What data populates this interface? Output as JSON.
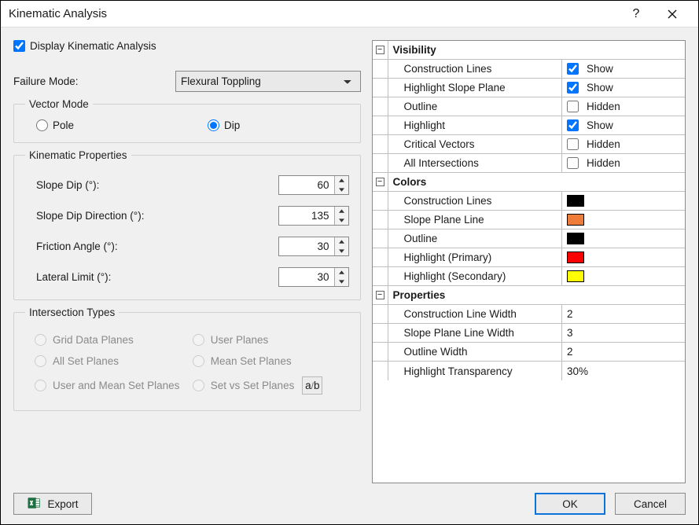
{
  "title": "Kinematic Analysis",
  "main_checkbox_label": "Display Kinematic Analysis",
  "main_checkbox_checked": true,
  "failure_mode": {
    "label": "Failure Mode:",
    "value": "Flexural Toppling"
  },
  "vector_mode": {
    "legend": "Vector Mode",
    "pole": "Pole",
    "dip": "Dip",
    "selected": "dip"
  },
  "kinematic_properties": {
    "legend": "Kinematic Properties",
    "slope_dip": {
      "label": "Slope Dip (°):",
      "value": "60"
    },
    "slope_dip_direction": {
      "label": "Slope Dip Direction (°):",
      "value": "135"
    },
    "friction_angle": {
      "label": "Friction Angle (°):",
      "value": "30"
    },
    "lateral_limit": {
      "label": "Lateral Limit (°):",
      "value": "30"
    }
  },
  "intersection_types": {
    "legend": "Intersection Types",
    "options": {
      "grid": "Grid Data Planes",
      "user": "User Planes",
      "allset": "All Set Planes",
      "meanset": "Mean Set Planes",
      "usermean": "User and Mean Set Planes",
      "setvs": "Set vs Set Planes"
    },
    "tool_btn": "a/b"
  },
  "propgrid": {
    "visibility": {
      "title": "Visibility",
      "rows": {
        "construction": {
          "name": "Construction Lines",
          "checked": true,
          "text": "Show"
        },
        "highlight_sp": {
          "name": "Highlight Slope Plane",
          "checked": true,
          "text": "Show"
        },
        "outline": {
          "name": "Outline",
          "checked": false,
          "text": "Hidden"
        },
        "highlight": {
          "name": "Highlight",
          "checked": true,
          "text": "Show"
        },
        "critical": {
          "name": "Critical Vectors",
          "checked": false,
          "text": "Hidden"
        },
        "allint": {
          "name": "All Intersections",
          "checked": false,
          "text": "Hidden"
        }
      }
    },
    "colors": {
      "title": "Colors",
      "rows": {
        "construction": {
          "name": "Construction Lines",
          "color": "#000000"
        },
        "slope_plane": {
          "name": "Slope Plane Line",
          "color": "#f07c3c"
        },
        "outline": {
          "name": "Outline",
          "color": "#000000"
        },
        "hl_primary": {
          "name": "Highlight (Primary)",
          "color": "#ff0000"
        },
        "hl_secondary": {
          "name": "Highlight (Secondary)",
          "color": "#ffff00"
        }
      }
    },
    "properties": {
      "title": "Properties",
      "rows": {
        "clw": {
          "name": "Construction Line Width",
          "value": "2"
        },
        "splw": {
          "name": "Slope Plane Line Width",
          "value": "3"
        },
        "ow": {
          "name": "Outline Width",
          "value": "2"
        },
        "ht": {
          "name": "Highlight Transparency",
          "value": "30%"
        }
      }
    }
  },
  "buttons": {
    "export": "Export",
    "ok": "OK",
    "cancel": "Cancel"
  }
}
